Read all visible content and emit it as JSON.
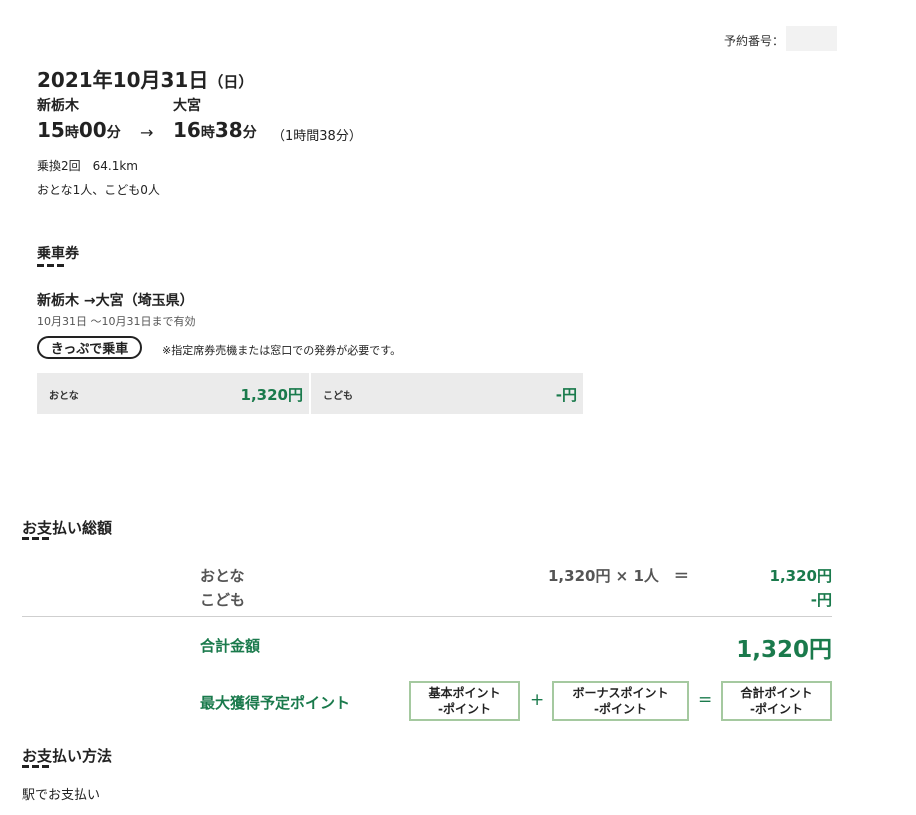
{
  "reservation": {
    "label": "予約番号：",
    "number": ""
  },
  "trip": {
    "date": "2021年10月31日",
    "day_of_week": "（日）",
    "departure_station": "新栃木",
    "arrival_station": "大宮",
    "departure_hour": "15",
    "departure_minute": "00",
    "arrival_hour": "16",
    "arrival_minute": "38",
    "hour_unit": "時",
    "minute_unit": "分",
    "arrow": "→",
    "duration": "（1時間38分）",
    "transfers": "乗換2回　64.1km",
    "passengers": "おとな1人、こども0人"
  },
  "ticket": {
    "heading": "乗車券",
    "route": "新栃木 →大宮（埼玉県）",
    "validity": "10月31日 ～10月31日まで有効",
    "kippu_button": "きっぷで乗車",
    "kippu_note": "※指定席券売機または窓口での発券が必要です。",
    "fares": [
      {
        "label": "おとな",
        "amount": "1,320円"
      },
      {
        "label": "こども",
        "amount": "-円"
      }
    ]
  },
  "total": {
    "heading": "お支払い総額",
    "adult_label": "おとな",
    "adult_calc": "1,320円 × 1人　＝",
    "adult_amount": "1,320円",
    "child_label": "こども",
    "child_amount": "-円",
    "sum_label": "合計金額",
    "sum_amount": "1,320円"
  },
  "points": {
    "label": "最大獲得予定ポイント",
    "basic_title": "基本ポイント",
    "basic_value": "-ポイント",
    "bonus_title": "ボーナスポイント",
    "bonus_value": "-ポイント",
    "total_title": "合計ポイント",
    "total_value": "-ポイント",
    "plus": "+",
    "equals": "="
  },
  "payment": {
    "heading": "お支払い方法",
    "method": "駅でお支払い"
  },
  "colors": {
    "accent_green": "#1a7a4c",
    "point_border": "#a5c9a0",
    "fare_bg": "#ebebeb"
  }
}
